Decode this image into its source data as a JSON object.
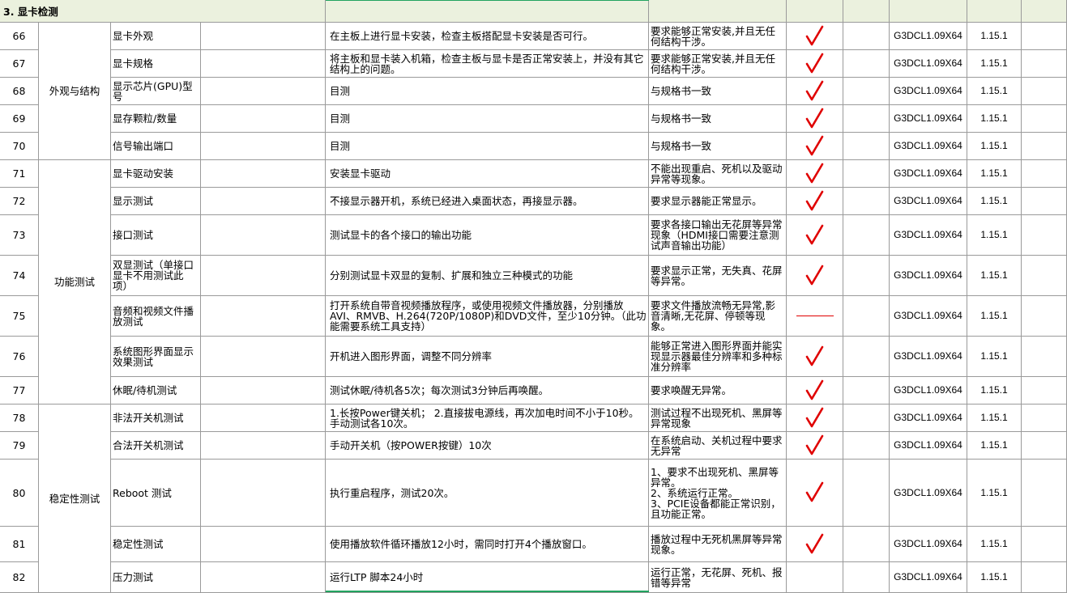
{
  "section_title": "3.  显卡检测",
  "groups": [
    {
      "label": "外观与结构"
    },
    {
      "label": "功能测试"
    },
    {
      "label": "稳定性测试"
    }
  ],
  "rows": [
    {
      "no": "66",
      "item": "显卡外观",
      "method": "在主板上进行显卡安装，检查主板搭配显卡安装是否可行。",
      "req": "要求能够正常安装,并且无任何结构干涉。",
      "result": "pass",
      "code": "G3DCL1.09X64",
      "ver": "1.15.1"
    },
    {
      "no": "67",
      "item": "显卡规格",
      "method": "将主板和显卡装入机箱，检查主板与显卡是否正常安装上，并没有其它结构上的问题。",
      "req": "要求能够正常安装,并且无任何结构干涉。",
      "result": "pass",
      "code": "G3DCL1.09X64",
      "ver": "1.15.1"
    },
    {
      "no": "68",
      "item": "显示芯片(GPU)型号",
      "method": "目测",
      "req": "与规格书一致",
      "result": "pass",
      "code": "G3DCL1.09X64",
      "ver": "1.15.1"
    },
    {
      "no": "69",
      "item": "显存颗粒/数量",
      "method": "目测",
      "req": "与规格书一致",
      "result": "pass",
      "code": "G3DCL1.09X64",
      "ver": "1.15.1"
    },
    {
      "no": "70",
      "item": "信号输出端口",
      "method": "目测",
      "req": "与规格书一致",
      "result": "pass",
      "code": "G3DCL1.09X64",
      "ver": "1.15.1"
    },
    {
      "no": "71",
      "item": "显卡驱动安装",
      "method": "安装显卡驱动",
      "req": "不能出现重启、死机以及驱动异常等现象。",
      "result": "pass",
      "code": "G3DCL1.09X64",
      "ver": "1.15.1"
    },
    {
      "no": "72",
      "item": "显示测试",
      "method": "不接显示器开机，系统已经进入桌面状态，再接显示器。",
      "req": "要求显示器能正常显示。",
      "result": "pass",
      "code": "G3DCL1.09X64",
      "ver": "1.15.1"
    },
    {
      "no": "73",
      "item": "接口测试",
      "method": "测试显卡的各个接口的输出功能",
      "req": "要求各接口输出无花屏等异常现象（HDMI接口需要注意测试声音输出功能）",
      "result": "pass",
      "code": "G3DCL1.09X64",
      "ver": "1.15.1"
    },
    {
      "no": "74",
      "item": "双显测试（单接口显卡不用测试此项）",
      "method": "分别测试显卡双显的复制、扩展和独立三种模式的功能",
      "req": "要求显示正常，无失真、花屏等异常。",
      "result": "pass",
      "code": "G3DCL1.09X64",
      "ver": "1.15.1"
    },
    {
      "no": "75",
      "item": "音频和视频文件播放测试",
      "method": "打开系统自带音视频播放程序，或使用视频文件播放器，分别播放AVI、RMVB、H.264(720P/1080P)和DVD文件，至少10分钟。（此功能需要系统工具支持）",
      "req": "要求文件播放流畅无异常,影音清晰,无花屏、停顿等现象。",
      "result": "na",
      "code": "G3DCL1.09X64",
      "ver": "1.15.1"
    },
    {
      "no": "76",
      "item": "系统图形界面显示效果测试",
      "method": "开机进入图形界面，调整不同分辨率",
      "req": "能够正常进入图形界面并能实现显示器最佳分辨率和多种标准分辨率",
      "result": "pass",
      "code": "G3DCL1.09X64",
      "ver": "1.15.1"
    },
    {
      "no": "77",
      "item": "休眠/待机测试",
      "method": "测试休眠/待机各5次；每次测试3分钟后再唤醒。",
      "req": "要求唤醒无异常。",
      "result": "pass",
      "code": "G3DCL1.09X64",
      "ver": "1.15.1"
    },
    {
      "no": "78",
      "item": "非法开关机测试",
      "method": "1.长按Power键关机； 2.直接拔电源线，再次加电时间不小于10秒。 手动测试各10次。",
      "req": "测试过程不出现死机、黑屏等异常现象",
      "result": "pass",
      "code": "G3DCL1.09X64",
      "ver": "1.15.1"
    },
    {
      "no": "79",
      "item": "合法开关机测试",
      "method": "手动开关机（按POWER按键）10次",
      "req": "在系统启动、关机过程中要求无异常",
      "result": "pass",
      "code": "G3DCL1.09X64",
      "ver": "1.15.1"
    },
    {
      "no": "80",
      "item": "Reboot 测试",
      "method": "执行重启程序，测试20次。",
      "req": "1、要求不出现死机、黑屏等异常。\n2、系统运行正常。\n3、PCIE设备都能正常识别，且功能正常。",
      "result": "pass",
      "code": "G3DCL1.09X64",
      "ver": "1.15.1"
    },
    {
      "no": "81",
      "item": "稳定性测试",
      "method": "使用播放软件循环播放12小时，需同时打开4个播放窗口。",
      "req": "播放过程中无死机黑屏等异常现象。",
      "result": "pass",
      "code": "G3DCL1.09X64",
      "ver": "1.15.1"
    },
    {
      "no": "82",
      "item": "压力测试",
      "method": "运行LTP 脚本24小时",
      "req": "运行正常，无花屏、死机、报错等异常",
      "result": "none",
      "code": "G3DCL1.09X64",
      "ver": "1.15.1"
    }
  ],
  "colors": {
    "check": "#e00000",
    "section_bg": "#ebf1de",
    "grid": "#9a9a9a",
    "selection": "#21a35f"
  },
  "icons": {
    "pass": "checkmark-icon",
    "na": "dash-icon"
  }
}
